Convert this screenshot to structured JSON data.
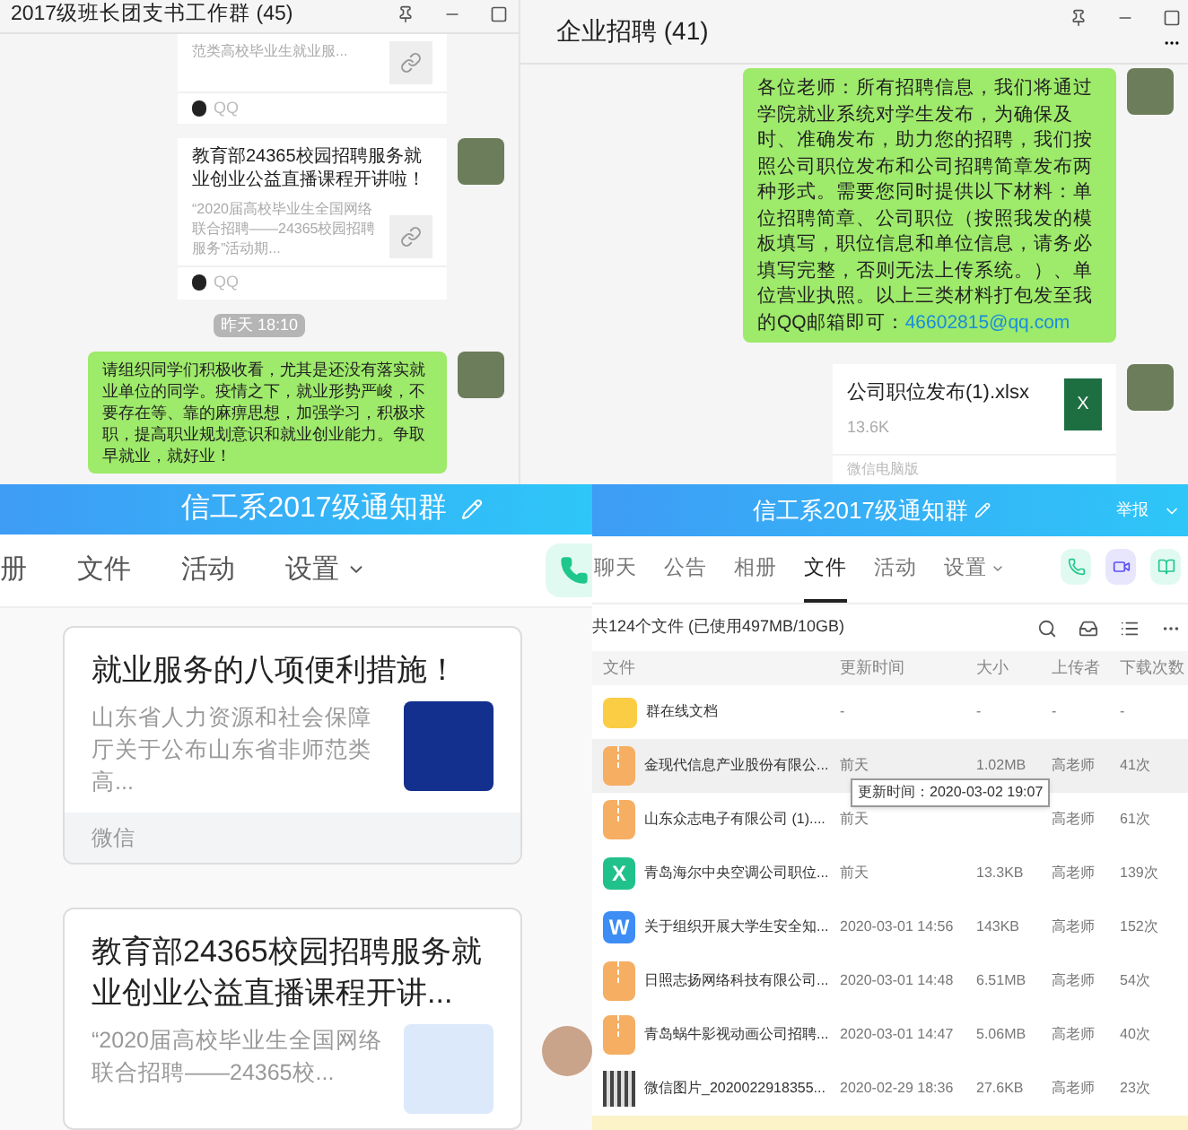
{
  "chat_left": {
    "title": "2017级班长团支书工作群 (45)",
    "messages": [
      {
        "kind": "link_card",
        "description": "范类高校毕业生就业服...",
        "source": "QQ"
      },
      {
        "kind": "link_card",
        "title": "教育部24365校园招聘服务就业创业公益直播课程开讲啦！",
        "description": "“2020届高校毕业生全国网络联合招聘——24365校园招聘服务”活动期...",
        "source": "QQ"
      },
      {
        "kind": "time",
        "text": "昨天 18:10"
      },
      {
        "kind": "text",
        "text": "请组织同学们积极收看，尤其是还没有落实就业单位的同学。疫情之下，就业形势严峻，不要存在等、靠的麻痹思想，加强学习，积极求职，提高职业规划意识和就业创业能力。争取早就业，就好业！"
      }
    ]
  },
  "chat_right": {
    "title": "企业招聘 (41)",
    "messages": [
      {
        "kind": "text",
        "text": "各位老师：所有招聘信息，我们将通过学院就业系统对学生发布，为确保及时、准确发布，助力您的招聘，我们按照公司职位发布和公司招聘简章发布两种形式。需要您同时提供以下材料：单位招聘简章、公司职位（按照我发的模板填写，职位信息和单位信息，请务必填写完整，否则无法上传系统。）、单位营业执照。以上三类材料打包发至我的QQ邮箱即可：",
        "link": "46602815@qq.com"
      },
      {
        "kind": "file",
        "name": "公司职位发布(1).xlsx",
        "size": "13.6K",
        "source": "微信电脑版",
        "icon_text": "X"
      }
    ]
  },
  "notice_group": {
    "title": "信工系2017级通知群",
    "tabs": [
      {
        "label": "册",
        "selected": false
      },
      {
        "label": "文件",
        "selected": false
      },
      {
        "label": "活动",
        "selected": false
      },
      {
        "label": "设置",
        "selected": false
      }
    ],
    "cards": [
      {
        "title": "就业服务的八项便利措施！",
        "description": "山东省人力资源和社会保障厅关于公布山东省非师范类高...",
        "source": "微信"
      },
      {
        "title": "教育部24365校园招聘服务就业创业公益直播课程开讲...",
        "description": "“2020届高校毕业生全国网络联合招聘——24365校..."
      }
    ]
  },
  "file_panel": {
    "title": "信工系2017级通知群",
    "report": "举报",
    "tabs": [
      {
        "label": "聊天",
        "selected": false
      },
      {
        "label": "公告",
        "selected": false
      },
      {
        "label": "相册",
        "selected": false
      },
      {
        "label": "文件",
        "selected": true
      },
      {
        "label": "活动",
        "selected": false
      },
      {
        "label": "设置",
        "selected": false
      }
    ],
    "summary": "共124个文件 (已使用497MB/10GB)",
    "columns": [
      "文件",
      "更新时间",
      "大小",
      "上传者",
      "下载次数"
    ],
    "rows": [
      {
        "kind": "folder",
        "name": "群在线文档",
        "time": "-",
        "size": "-",
        "uploader": "-",
        "downloads": "-",
        "selected": false
      },
      {
        "kind": "zip",
        "name": "金现代信息产业股份有限公...",
        "time": "前天",
        "size": "1.02MB",
        "uploader": "高老师",
        "downloads": "41次",
        "selected": true
      },
      {
        "kind": "zip",
        "name": "山东众志电子有限公司 (1)....",
        "time": "前天",
        "uploader": "高老师",
        "downloads": "61次",
        "selected": false
      },
      {
        "kind": "excel",
        "icon_text": "X",
        "name": "青岛海尔中央空调公司职位...",
        "time": "前天",
        "size": "13.3KB",
        "uploader": "高老师",
        "downloads": "139次",
        "selected": false
      },
      {
        "kind": "word",
        "icon_text": "W",
        "name": "关于组织开展大学生安全知...",
        "time": "2020-03-01 14:56",
        "size": "143KB",
        "uploader": "高老师",
        "downloads": "152次",
        "selected": false
      },
      {
        "kind": "zip",
        "name": "日照志扬网络科技有限公司...",
        "time": "2020-03-01 14:48",
        "size": "6.51MB",
        "uploader": "高老师",
        "downloads": "54次",
        "selected": false
      },
      {
        "kind": "zip",
        "name": "青岛蜗牛影视动画公司招聘...",
        "time": "2020-03-01 14:47",
        "size": "5.06MB",
        "uploader": "高老师",
        "downloads": "40次",
        "selected": false
      },
      {
        "kind": "image",
        "name": "微信图片_2020022918355...",
        "time": "2020-02-29 18:36",
        "size": "27.6KB",
        "uploader": "高老师",
        "downloads": "23次",
        "selected": false
      }
    ],
    "tooltip": "更新时间：2020-03-02 19:07"
  }
}
